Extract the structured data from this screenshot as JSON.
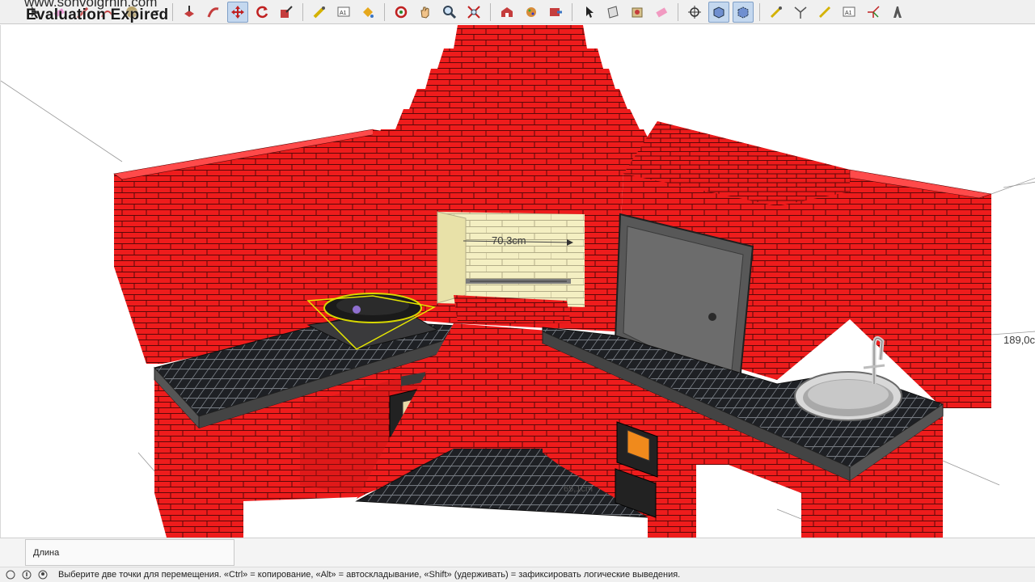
{
  "watermark": {
    "site": "www.sonvoigrnin.com",
    "status": "Evaluation Expired"
  },
  "toolbar": {
    "groups": [
      [
        "select-tool",
        "eraser-tool",
        "line-tool",
        "arc-tool",
        "rectangle-tool",
        "push-pull-tool"
      ],
      [
        "follow-me-tool",
        "move-tool",
        "rotate-tool",
        "scale-tool"
      ],
      [
        "tape-measure-tool",
        "text-tool",
        "paint-bucket-tool"
      ],
      [
        "orbit-tool",
        "pan-tool",
        "zoom-tool",
        "zoom-extents-tool"
      ],
      [
        "warehouse-tool",
        "component-tool",
        "send-to-layout-tool"
      ],
      [
        "sandbox-select-tool",
        "section-tool",
        "material-tool",
        "eraser-soft-tool"
      ],
      [
        "position-camera-tool",
        "xray-tool",
        "back-edges-tool"
      ],
      [
        "dimension-tool",
        "protractor-tool",
        "axes-tool",
        "text-3d-tool",
        "walk-tool",
        "look-around-tool"
      ]
    ],
    "active": [
      "move-tool",
      "xray-tool",
      "back-edges-tool"
    ]
  },
  "viewport": {
    "dimensions": {
      "grill_width": "70,3cm",
      "height": "189,0c",
      "depth": "65,1cm"
    },
    "colors": {
      "brick": "#ee1c1c",
      "mortar": "#5a0808",
      "tile": "#1e2024",
      "firebox": "#f4efc2",
      "door": "#6c6c6c"
    }
  },
  "measurements": {
    "label": "Длина"
  },
  "statusbar": {
    "hint": "Выберите две точки для перемещения.  «Ctrl» = копирование, «Alt» = автоскладывание, «Shift» (удерживать) = зафиксировать логические выведения."
  }
}
